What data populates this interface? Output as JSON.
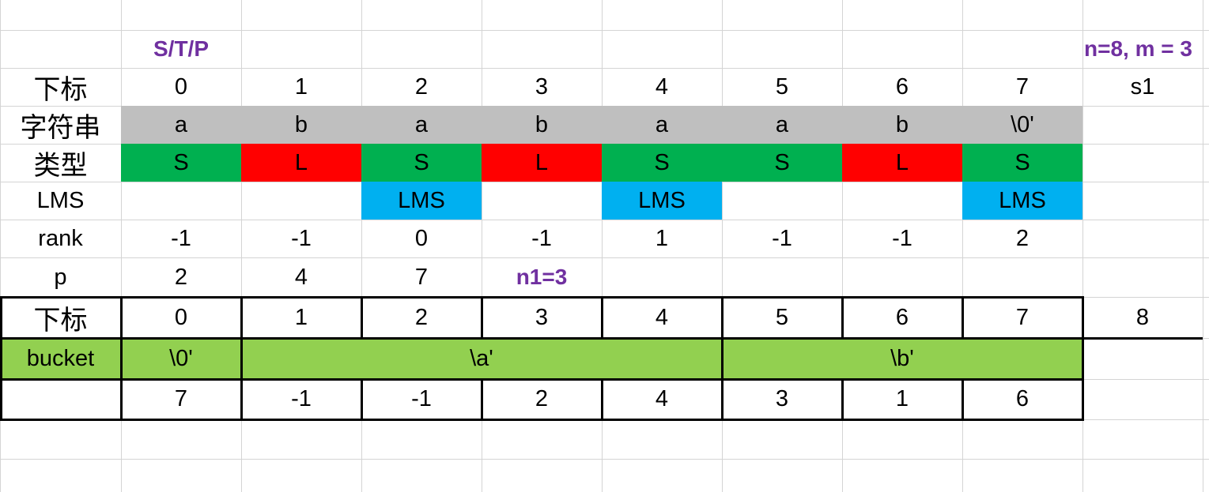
{
  "top": {
    "left_label": "S/T/P",
    "right_label": "n=8, m = 3"
  },
  "rows": {
    "index": {
      "label": "下标",
      "values": [
        "0",
        "1",
        "2",
        "3",
        "4",
        "5",
        "6",
        "7"
      ],
      "extra": "s1"
    },
    "string": {
      "label": "字符串",
      "values": [
        "a",
        "b",
        "a",
        "b",
        "a",
        "a",
        "b",
        "\\0'"
      ]
    },
    "type": {
      "label": "类型",
      "values": [
        "S",
        "L",
        "S",
        "L",
        "S",
        "S",
        "L",
        "S"
      ]
    },
    "lms": {
      "label": "LMS",
      "values": [
        "",
        "",
        "LMS",
        "",
        "LMS",
        "",
        "",
        "LMS"
      ]
    },
    "rank": {
      "label": "rank",
      "values": [
        "-1",
        "-1",
        "0",
        "-1",
        "1",
        "-1",
        "-1",
        "2"
      ]
    },
    "p": {
      "label": "p",
      "values": [
        "2",
        "4",
        "7"
      ],
      "note": "n1=3"
    }
  },
  "table": {
    "index_label": "下标",
    "index_values": [
      "0",
      "1",
      "2",
      "3",
      "4",
      "5",
      "6",
      "7",
      "8"
    ],
    "bucket_label": "bucket",
    "buckets": [
      "\\0'",
      "\\a'",
      "\\b'"
    ],
    "values": [
      "7",
      "-1",
      "-1",
      "2",
      "4",
      "3",
      "1",
      "6"
    ]
  },
  "colors": {
    "gray": "#bfbfbf",
    "green": "#00b050",
    "red": "#ff0000",
    "blue": "#00b0f0",
    "lime": "#92d050",
    "purple": "#7030a0"
  }
}
